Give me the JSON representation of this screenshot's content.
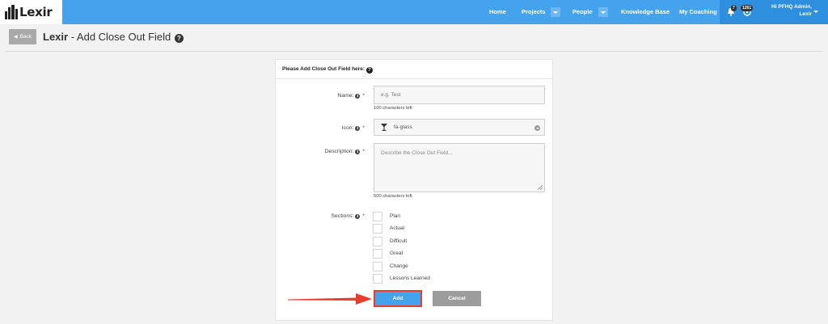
{
  "app": {
    "logo_text": "Lexir"
  },
  "nav": {
    "home": "Home",
    "projects": "Projects",
    "people": "People",
    "knowledge_base": "Knowledge Base",
    "my_coaching": "My Coaching",
    "alerts_count": "7",
    "messages_count": "1261",
    "user_greeting": "Hi PFHQ Admin,",
    "user_org": "Lexir"
  },
  "header": {
    "back_label": "Back",
    "title_brand": "Lexir",
    "title_rest": " - Add Close Out Field",
    "help_glyph": "?"
  },
  "form": {
    "panel_title": "Please Add Close Out Field here:",
    "panel_help_glyph": "?",
    "name": {
      "label": "Name:",
      "placeholder": "e.g. Test",
      "hint": "100 characters left"
    },
    "icon": {
      "label": "Icon:",
      "value": "fa-glass"
    },
    "description": {
      "label": "Description:",
      "placeholder": "Describe the Close Out Field...",
      "hint": "500 characters left"
    },
    "sections": {
      "label": "Sections:",
      "options": [
        "Plan",
        "Actual",
        "Difficult",
        "Great",
        "Change",
        "Lessons Learned"
      ]
    },
    "required_mark": "*",
    "info_glyph": "i",
    "add_label": "Add",
    "cancel_label": "Cancel"
  },
  "colors": {
    "navbar": "#45a3ee",
    "nav_active": "#2f8fdf",
    "primary_button": "#45a3ee",
    "cancel_button": "#9c9c9c",
    "highlight": "#e73c2e"
  }
}
